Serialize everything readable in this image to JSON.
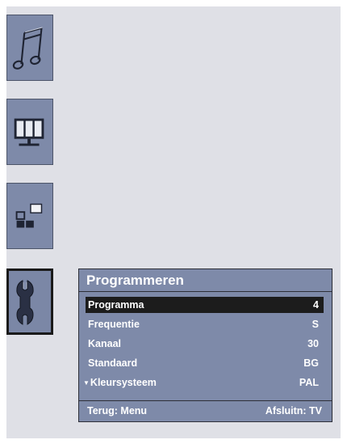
{
  "sidebar": {
    "items": [
      {
        "icon": "music-note-icon",
        "active": false
      },
      {
        "icon": "tv-screen-icon",
        "active": false
      },
      {
        "icon": "pip-layout-icon",
        "active": false
      },
      {
        "icon": "wrench-icon",
        "active": true
      }
    ]
  },
  "menu": {
    "title": "Programmeren",
    "rows": [
      {
        "label": "Programma",
        "value": "4",
        "selected": true
      },
      {
        "label": "Frequentie",
        "value": "S",
        "selected": false
      },
      {
        "label": "Kanaal",
        "value": "30",
        "selected": false
      },
      {
        "label": "Standaard",
        "value": "BG",
        "selected": false
      },
      {
        "label": "Kleursysteem",
        "value": "PAL",
        "selected": false,
        "arrow": "▼"
      }
    ],
    "footer_left": "Terug: Menu",
    "footer_right": "Afsluitn: TV"
  },
  "colors": {
    "screen_bg": "#dfe0e6",
    "tile_bg": "#7e8aa9",
    "selected_row": "#1c1c1c",
    "text": "#ffffff"
  }
}
